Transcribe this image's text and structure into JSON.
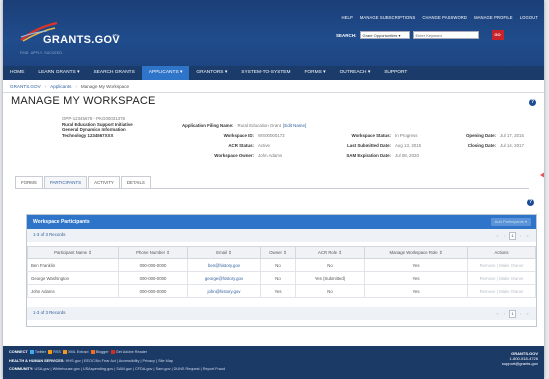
{
  "header": {
    "top_links": [
      "HELP",
      "MANAGE SUBSCRIPTIONS",
      "CHANGE PASSWORD",
      "MANAGE PROFILE",
      "LOGOUT"
    ],
    "logo_text": "GRANTS.GOV",
    "logo_tm": "SM",
    "tagline": "FIND. APPLY. SUCCEED.",
    "search_label": "SEARCH:",
    "search_scope": "Grant Opportunities",
    "search_placeholder": "Enter Keyword",
    "go_label": "GO"
  },
  "nav": {
    "items": [
      "HOME",
      "LEARN GRANTS",
      "SEARCH GRANTS",
      "APPLICANTS",
      "GRANTORS",
      "SYSTEM-TO-SYSTEM",
      "FORMS",
      "OUTREACH",
      "SUPPORT"
    ],
    "active": "APPLICANTS"
  },
  "breadcrumb": {
    "items": [
      "GRANTS.GOV",
      "Applicants",
      "Manage My Workspace"
    ],
    "separator": "›"
  },
  "page": {
    "title": "MANAGE MY WORKSPACE",
    "help_icon": "?"
  },
  "workspace": {
    "opportunity_id": "OPP-12345678 - PKG00031378",
    "org_lines": [
      "Rural Education Support Initiative",
      "General Dynamics Information",
      "Technology 1234567XXX"
    ],
    "application_filing_name_label": "Application Filing Name:",
    "application_filing_name_value": "Rural Education Grant",
    "edit_name_link": "[Edit Name]",
    "workspace_id_label": "Workspace ID:",
    "workspace_id_value": "WS00000173",
    "acr_status_label": "ACR Status:",
    "acr_status_value": "Active",
    "workspace_owner_label": "Workspace Owner:",
    "workspace_owner_value": "John Adams",
    "workspace_status_label": "Workspace Status:",
    "workspace_status_value": "In Progress",
    "last_submitted_label": "Last Submitted Date:",
    "last_submitted_value": "Aug 13, 2015",
    "sam_expiration_label": "SAM Expiration Date:",
    "sam_expiration_value": "Jul 08, 2020",
    "opening_date_label": "Opening Date:",
    "opening_date_value": "Jul 17, 2015",
    "closing_date_label": "Closing Date:",
    "closing_date_value": "Jul 14, 2017"
  },
  "tabs": [
    "FORMS",
    "PARTICIPANTS",
    "ACTIVITY",
    "DETAILS"
  ],
  "active_tab": "PARTICIPANTS",
  "participants": {
    "panel_title": "Workspace Participants",
    "add_button": "Add Participants",
    "record_count_top": "1-3 of 3 Records",
    "record_count_bottom": "1-3 of 3 Records",
    "page_number": "1",
    "columns": [
      "Participant Name",
      "Phone Number",
      "Email",
      "Owner",
      "ACR Role",
      "Manage Workspace Role",
      "Actions"
    ],
    "rows": [
      {
        "name": "Ben Franklin",
        "phone": "000-000-0000",
        "email": "ben@history.gov",
        "owner": "No",
        "acr_role": "No",
        "manage_role": "Yes",
        "actions": "Remove | Make Owner"
      },
      {
        "name": "George Washington",
        "phone": "000-000-0000",
        "email": "george@history.gov",
        "owner": "No",
        "acr_role": "Yes (Submitted)",
        "manage_role": "Yes",
        "actions": "Remove | Make Owner"
      },
      {
        "name": "John Adams",
        "phone": "000-000-0000",
        "email": "john@history.gov",
        "owner": "Yes",
        "acr_role": "No",
        "manage_role": "Yes",
        "actions": "Remove | Make Owner"
      }
    ]
  },
  "footer": {
    "connect_label": "CONNECT",
    "connect_items": [
      "Twitter",
      "RSS",
      "XML Extract",
      "Blogger",
      "Get Adobe Reader"
    ],
    "row2_label": "HEALTH & HUMAN SERVICES:",
    "row2_items": [
      "HHS.gov",
      "EEOC/No Fear Act",
      "Accessibility",
      "Privacy",
      "Site Map"
    ],
    "row3_label": "COMMUNITY:",
    "row3_items": [
      "USA.gov",
      "Whitehouse.gov",
      "USAspending.gov",
      "SAM.gov",
      "CFDA.gov",
      "Sam.gov",
      "DUNS Request",
      "Report Fraud"
    ],
    "brand": "GRANTS.GOV",
    "phone": "1-800-518-4726",
    "email": "support@grants.gov"
  },
  "colors": {
    "header_blue": "#1b3f77",
    "nav_active": "#2e74c9",
    "go_red": "#c8222b",
    "link_blue": "#2f5e9e",
    "annotation_arrow": "#e1575a"
  }
}
